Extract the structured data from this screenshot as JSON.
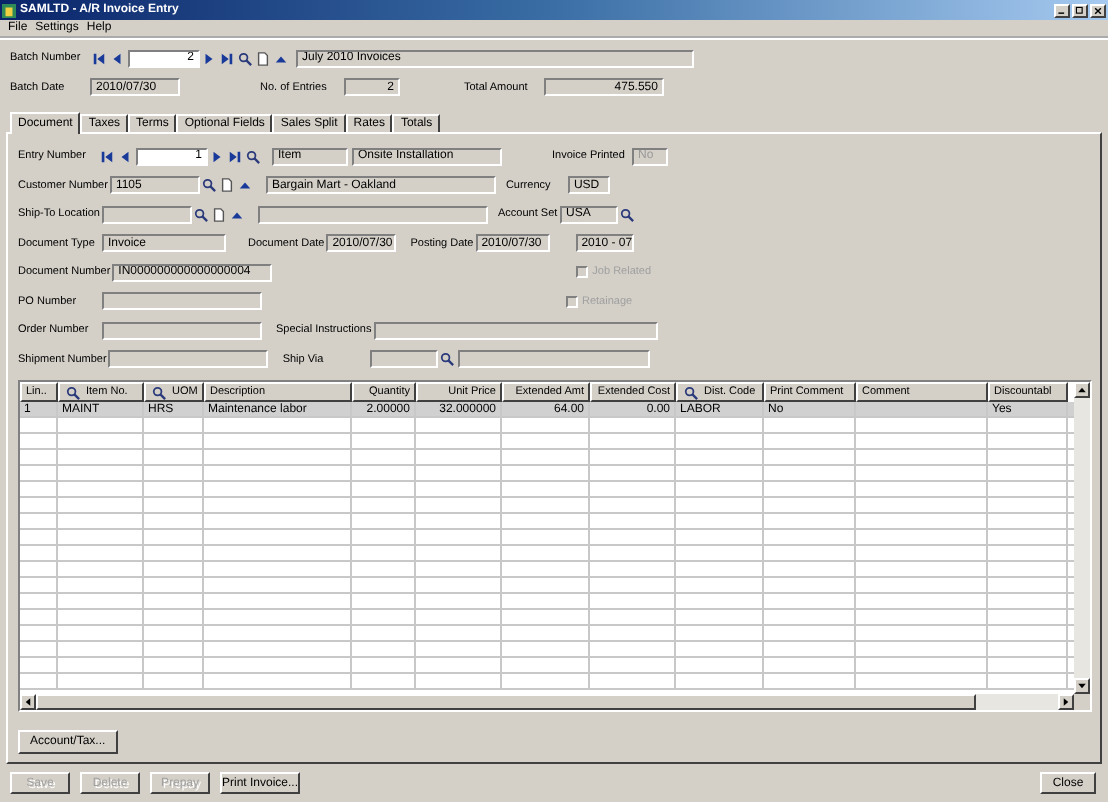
{
  "window": {
    "title": "SAMLTD - A/R Invoice Entry"
  },
  "menu": [
    {
      "label": "File"
    },
    {
      "label": "Settings"
    },
    {
      "label": "Help"
    }
  ],
  "batch": {
    "number_label": "Batch Number",
    "number": "2",
    "description": "July 2010 Invoices",
    "date_label": "Batch Date",
    "date": "2010/07/30",
    "entries_label": "No. of Entries",
    "entries": "2",
    "total_label": "Total Amount",
    "total": "475.550"
  },
  "tabs": [
    {
      "label": "Document",
      "selected": true
    },
    {
      "label": "Taxes",
      "selected": false
    },
    {
      "label": "Terms",
      "selected": false
    },
    {
      "label": "Optional Fields",
      "selected": false
    },
    {
      "label": "Sales Split",
      "selected": false
    },
    {
      "label": "Rates",
      "selected": false
    },
    {
      "label": "Totals",
      "selected": false
    }
  ],
  "document": {
    "entry": {
      "label": "Entry Number",
      "value": "1",
      "type_value": "Item",
      "description": "Onsite Installation"
    },
    "invoice_printed": {
      "label": "Invoice Printed",
      "value": "No",
      "disabled": true
    },
    "customer": {
      "label": "Customer Number",
      "value": "1105",
      "name": "Bargain Mart - Oakland"
    },
    "currency": {
      "label": "Currency",
      "value": "USD"
    },
    "ship_to": {
      "label": "Ship-To Location"
    },
    "account_set": {
      "label": "Account Set",
      "value": "USA"
    },
    "document_type": {
      "label": "Document Type",
      "value": "Invoice"
    },
    "document_date": {
      "label": "Document Date",
      "value": "2010/07/30"
    },
    "posting_date": {
      "label": "Posting Date",
      "value": "2010/07/30"
    },
    "fiscal_period": {
      "value": "2010 - 07"
    },
    "document_number": {
      "label": "Document Number",
      "value": "IN000000000000000004"
    },
    "job_related": {
      "label": "Job Related",
      "checked": false,
      "disabled": true
    },
    "po_number": {
      "label": "PO Number"
    },
    "retainage": {
      "label": "Retainage",
      "checked": false,
      "disabled": true
    },
    "order_number": {
      "label": "Order Number"
    },
    "special_instructions": {
      "label": "Special Instructions"
    },
    "shipment_number": {
      "label": "Shipment Number"
    },
    "ship_via": {
      "label": "Ship Via"
    }
  },
  "grid": {
    "columns": [
      {
        "label": "Lin..",
        "finder": false
      },
      {
        "label": "Item No.",
        "finder": true
      },
      {
        "label": "UOM",
        "finder": true
      },
      {
        "label": "Description",
        "finder": false
      },
      {
        "label": "Quantity",
        "finder": false
      },
      {
        "label": "Unit Price",
        "finder": false
      },
      {
        "label": "Extended Amt",
        "finder": false
      },
      {
        "label": "Extended Cost",
        "finder": false
      },
      {
        "label": "Dist. Code",
        "finder": true
      },
      {
        "label": "Print Comment",
        "finder": false
      },
      {
        "label": "Comment",
        "finder": false
      },
      {
        "label": "Discountabl",
        "finder": false
      }
    ],
    "rows": [
      {
        "selected": true,
        "cells": [
          "1",
          "MAINT",
          "HRS",
          "Maintenance labor",
          "2.00000",
          "32.000000",
          "64.00",
          "0.00",
          "LABOR",
          "No",
          null,
          "Yes"
        ]
      }
    ]
  },
  "panel_buttons": [
    {
      "label": "Account/Tax...",
      "disabled": false
    }
  ],
  "buttons": [
    {
      "label": "Save",
      "disabled": true
    },
    {
      "label": "Delete",
      "disabled": true
    },
    {
      "label": "Prepay",
      "disabled": true
    },
    {
      "label": "Print Invoice...",
      "disabled": false
    }
  ],
  "close": {
    "label": "Close",
    "disabled": false
  }
}
